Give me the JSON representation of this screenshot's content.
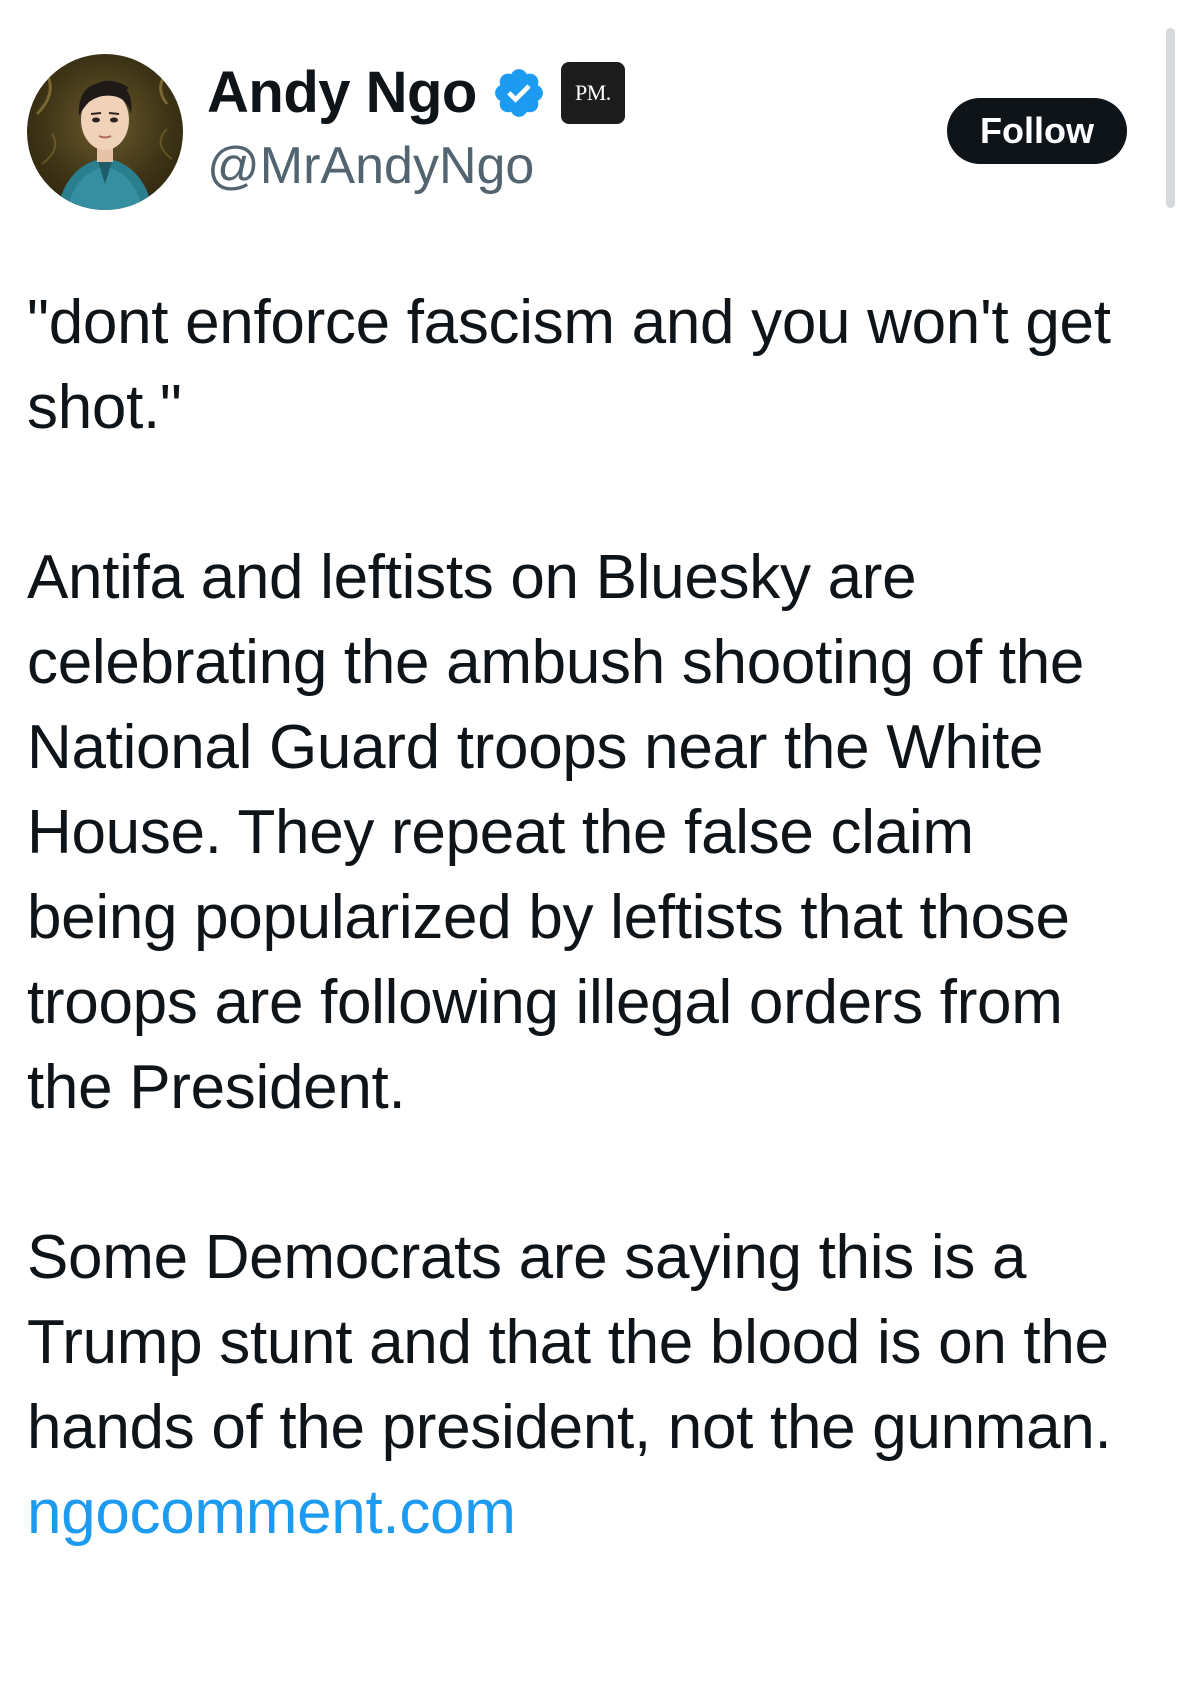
{
  "author": {
    "display_name": "Andy Ngo",
    "handle": "@MrAndyNgo",
    "verified_icon": "verified-badge-icon",
    "affiliation_badge": "PM.",
    "avatar_icon": "profile-avatar"
  },
  "actions": {
    "follow_label": "Follow"
  },
  "tweet": {
    "paragraph_1": "\"dont enforce fascism and you won't get shot.\"",
    "paragraph_2": "Antifa and leftists on Bluesky are celebrating the ambush shooting of the National Guard troops near the White House. They repeat the false claim being popularized by leftists that those troops are following illegal orders from the President.",
    "paragraph_3_text": "Some Democrats are saying this is a Trump stunt and that the blood is on the hands of the president, not the gunman.",
    "paragraph_3_link": "ngocomment.com"
  },
  "colors": {
    "text": "#0f1419",
    "secondary_text": "#536471",
    "link": "#1d9bf0",
    "verified": "#1d9bf0",
    "follow_bg": "#0f1419"
  }
}
